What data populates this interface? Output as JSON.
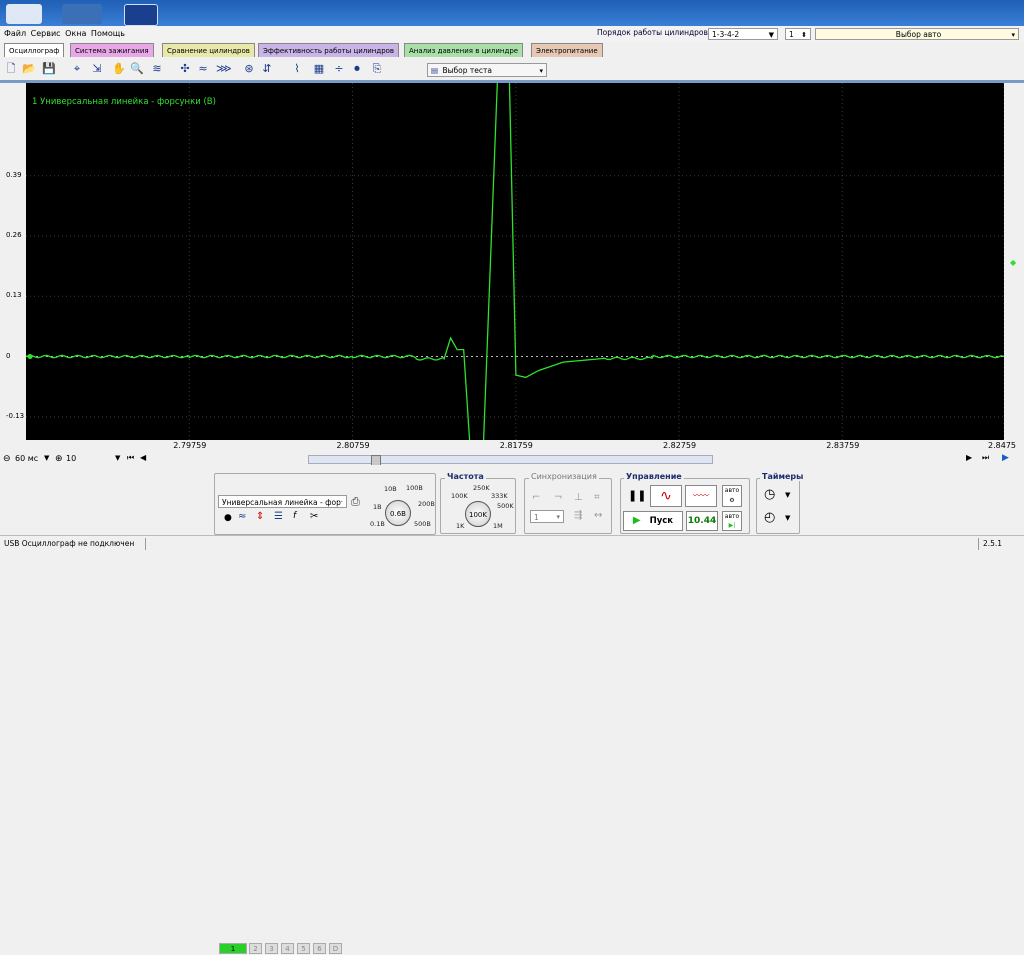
{
  "menu": {
    "items": [
      "Файл",
      "Сервис",
      "Окна",
      "Помощь"
    ],
    "cylinder_order_label": "Порядок работы цилиндров",
    "cylinder_order_value": "1-3-4-2",
    "cylinder_number": "1",
    "vehicle_select": "Выбор авто"
  },
  "tabs": [
    {
      "label": "Осциллограф",
      "color": "#f0f0f0"
    },
    {
      "label": "Система зажигания",
      "color": "#e8a8e8"
    },
    {
      "label": "Сравнение цилиндров",
      "color": "#e8e8a8"
    },
    {
      "label": "Эффективность работы цилиндров",
      "color": "#c8b4e6"
    },
    {
      "label": "Анализ давления в цилиндре",
      "color": "#a8e0a8"
    },
    {
      "label": "Электропитание",
      "color": "#e6c8b4"
    }
  ],
  "toolbar": {
    "test_select": "Выбор теста",
    "icons": [
      "new-file-icon",
      "open-folder-icon",
      "save-icon",
      "cursor-icon",
      "measure-icon",
      "hand-icon",
      "zoom-icon",
      "filter-icon",
      "auto-scale-icon",
      "overlay-icon",
      "compare-icon",
      "trigger-icon",
      "offset-icon",
      "marker-icon",
      "grid-icon",
      "split-icon",
      "record-icon",
      "export-icon"
    ]
  },
  "scope": {
    "trace_label": "1 Универсальная линейка - форсунки (В)",
    "y_labels": [
      "0.39",
      "0.26",
      "0.13",
      "0",
      "-0.13"
    ],
    "x_labels": [
      "2.79759",
      "2.80759",
      "2.81759",
      "2.82759",
      "2.83759",
      "2.8475"
    ],
    "colors": {
      "background": "#000000",
      "trace": "#2fe02f",
      "grid": "#3a3a3a"
    }
  },
  "chart_data": {
    "type": "line",
    "title": "1 Универсальная линейка - форсунки (В)",
    "xlabel": "",
    "ylabel": "",
    "x": [
      2.78759,
      2.79759,
      2.80759,
      2.8115,
      2.8132,
      2.8136,
      2.814,
      2.8144,
      2.8148,
      2.8156,
      2.8168,
      2.8172,
      2.8176,
      2.8182,
      2.819,
      2.8205,
      2.823,
      2.826,
      2.83759,
      2.8475
    ],
    "series": [
      {
        "values": [
          0,
          0,
          0,
          -0.005,
          -0.005,
          0.04,
          0.015,
          0.015,
          -0.2,
          -0.2,
          0.9,
          0.6,
          -0.04,
          -0.045,
          -0.03,
          -0.012,
          -0.004,
          0,
          0,
          0
        ]
      }
    ],
    "xlim": [
      2.78759,
      2.8475
    ],
    "ylim": [
      -0.18,
      0.59
    ],
    "y_ticks": [
      0.39,
      0.26,
      0.13,
      0,
      -0.13
    ],
    "x_ticks": [
      "2.79759",
      "2.80759",
      "2.81759",
      "2.82759",
      "2.83759",
      "2.8475"
    ],
    "grid": true
  },
  "controls": {
    "timebase": "60 мс",
    "offset": "10",
    "channels": [
      "1",
      "2",
      "3",
      "4",
      "5",
      "6",
      "D"
    ],
    "probe_select": "Универсальная линейка - фор",
    "range_knob": "0.6В",
    "range_labels": [
      "10В",
      "100В",
      "1В",
      "200В",
      "0.1В",
      "500В"
    ],
    "freq_title": "Частота",
    "freq_knob": "100K",
    "freq_labels": [
      "250K",
      "100K",
      "333K",
      "500K",
      "1K",
      "1M"
    ],
    "sync_title": "Синхронизация",
    "sync_value": "1",
    "control_title": "Управление",
    "start_button": "Пуск",
    "display_value": "10.44",
    "auto_label": "авто",
    "timers_title": "Таймеры"
  },
  "status": {
    "text": "USB Осциллограф не подключен",
    "version": "2.5.1"
  }
}
